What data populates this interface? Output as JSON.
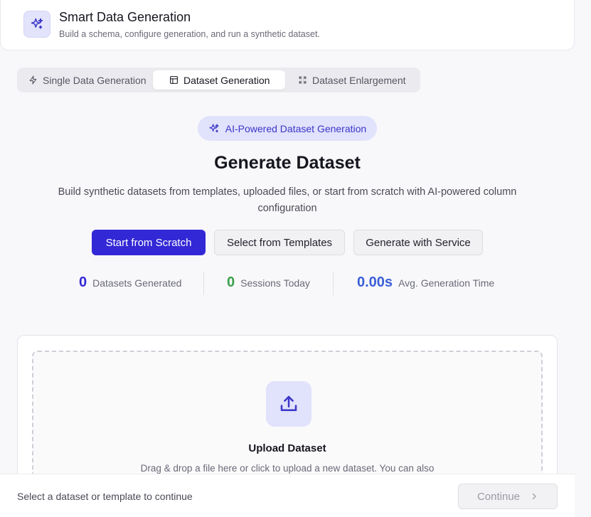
{
  "header": {
    "title": "Smart Data Generation",
    "subtitle": "Build a schema, configure generation, and run a synthetic dataset.",
    "icon": "sparkles-icon"
  },
  "tabs": [
    {
      "label": "Single Data Generation",
      "icon": "lightning-icon",
      "active": false
    },
    {
      "label": "Dataset Generation",
      "icon": "table-icon",
      "active": true
    },
    {
      "label": "Dataset Enlargement",
      "icon": "expand-icon",
      "active": false
    }
  ],
  "hero": {
    "badge": "AI-Powered Dataset Generation",
    "title": "Generate Dataset",
    "description": "Build synthetic datasets from templates, uploaded files, or start from scratch with AI-powered column configuration"
  },
  "actions": {
    "scratch": "Start from Scratch",
    "templates": "Select from Templates",
    "service": "Generate with Service"
  },
  "stats": [
    {
      "value": "0",
      "label": "Datasets Generated",
      "color": "#3328d6"
    },
    {
      "value": "0",
      "label": "Sessions Today",
      "color": "#3aa04a"
    },
    {
      "value": "0.00s",
      "label": "Avg. Generation Time",
      "color": "#3a5fd6"
    }
  ],
  "upload": {
    "title": "Upload Dataset",
    "description": "Drag & drop a file here or click to upload a new dataset. You can also",
    "icon": "upload-icon"
  },
  "footer": {
    "status": "Select a dataset or template to continue",
    "continue_label": "Continue"
  },
  "colors": {
    "accent": "#3328d6",
    "accent_soft": "#e1e2fb"
  }
}
